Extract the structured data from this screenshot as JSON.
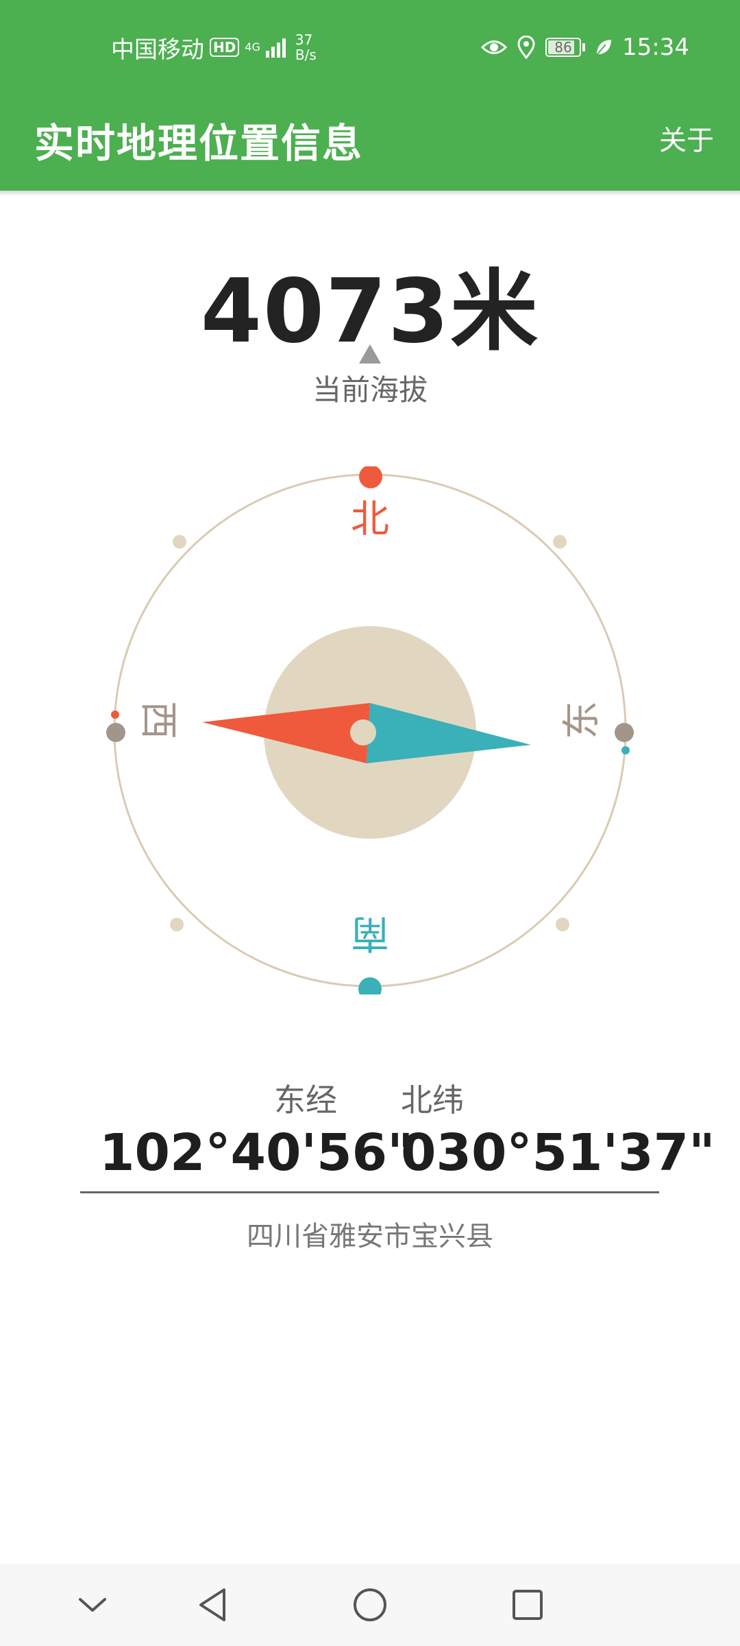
{
  "status_bar": {
    "carrier": "中国移动",
    "hd": "HD",
    "network_type": "4G",
    "speed_value": "37",
    "speed_unit": "B/s",
    "battery": "86",
    "time": "15:34"
  },
  "app_bar": {
    "title": "实时地理位置信息",
    "about_label": "关于"
  },
  "altitude": {
    "value": "4073米",
    "label": "当前海拔"
  },
  "compass": {
    "north": "北",
    "south": "南",
    "west": "西",
    "east": "东",
    "colors": {
      "north": "#ef5a3c",
      "south": "#3ab0b8",
      "ring": "#d9cbb3",
      "hub": "#e1d7c1",
      "side": "#a4958a"
    }
  },
  "coordinates": {
    "longitude_label": "东经",
    "longitude_value": "102°40'56\"",
    "latitude_label": "北纬",
    "latitude_value": "030°51'37\""
  },
  "address": "四川省雅安市宝兴县",
  "nav_bar": {
    "icons": [
      "chevron-down-icon",
      "back-icon",
      "home-icon",
      "recents-icon"
    ]
  }
}
